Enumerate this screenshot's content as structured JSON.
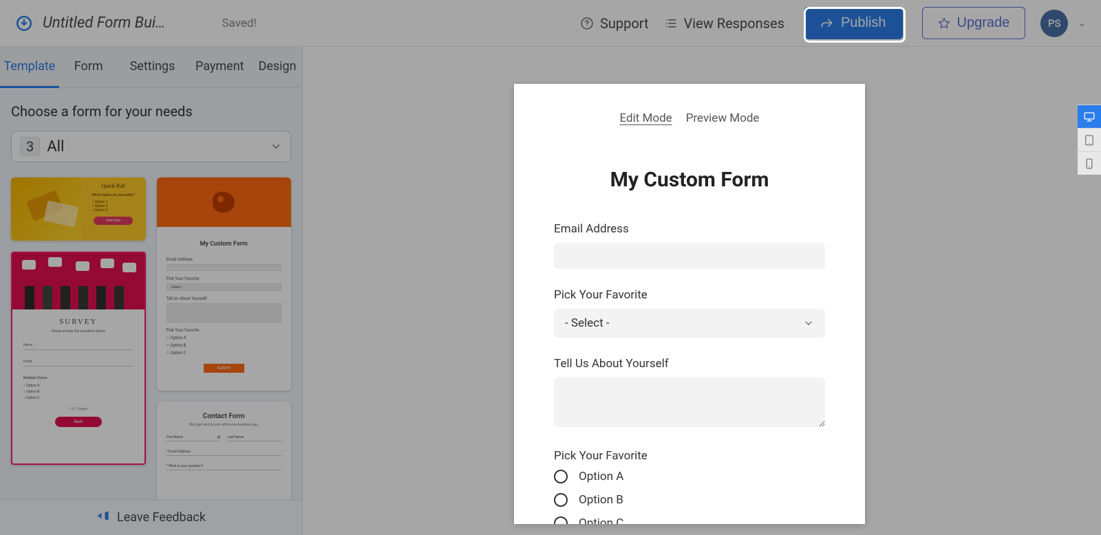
{
  "topbar": {
    "title": "Untitled Form Bui…",
    "saved": "Saved!",
    "support": "Support",
    "view_responses": "View Responses",
    "publish": "Publish",
    "upgrade": "Upgrade",
    "avatar": "PS"
  },
  "sidepanel": {
    "tabs": [
      "Template",
      "Form",
      "Settings",
      "Payment",
      "Design"
    ],
    "choose": "Choose a form for your needs",
    "filter": {
      "count": "3",
      "label": "All"
    },
    "templates": {
      "t1": {
        "title": "Quick Poll",
        "question": "Which option do you prefer?",
        "opt1": "Option 1",
        "opt2": "Option 2",
        "opt3": "Option 3",
        "btn": "Vote Now"
      },
      "t2": {
        "title": "My Custom Form",
        "l_email": "Email Address",
        "l_fav": "Pick Your Favorite",
        "sel": "- Select -",
        "l_about": "Tell Us About Yourself",
        "r1": "Option A",
        "r2": "Option B",
        "r3": "Option C",
        "submit": "Submit"
      },
      "t3": {
        "title": "SURVEY",
        "sub": "Please answer the questions below",
        "name": "Name",
        "email": "Email",
        "mc": "Multiple Choice",
        "oA": "Option A",
        "oB": "Option B",
        "oC": "Option C",
        "page": "1 of 2 pages",
        "next": "Next"
      },
      "t4": {
        "title": "Contact Form",
        "sub": "We'll get back to you within one business day.",
        "fn": "First Name",
        "ln": "Last Name",
        "email": "* Email Address",
        "q": "* What is your question?"
      }
    },
    "feedback": "Leave Feedback"
  },
  "form": {
    "mode_edit": "Edit Mode",
    "mode_preview": "Preview Mode",
    "title": "My Custom Form",
    "email": "Email Address",
    "fav": "Pick Your Favorite",
    "sel": "- Select -",
    "about": "Tell Us About Yourself",
    "fav2": "Pick Your Favorite",
    "oA": "Option A",
    "oB": "Option B",
    "oC": "Option C"
  }
}
